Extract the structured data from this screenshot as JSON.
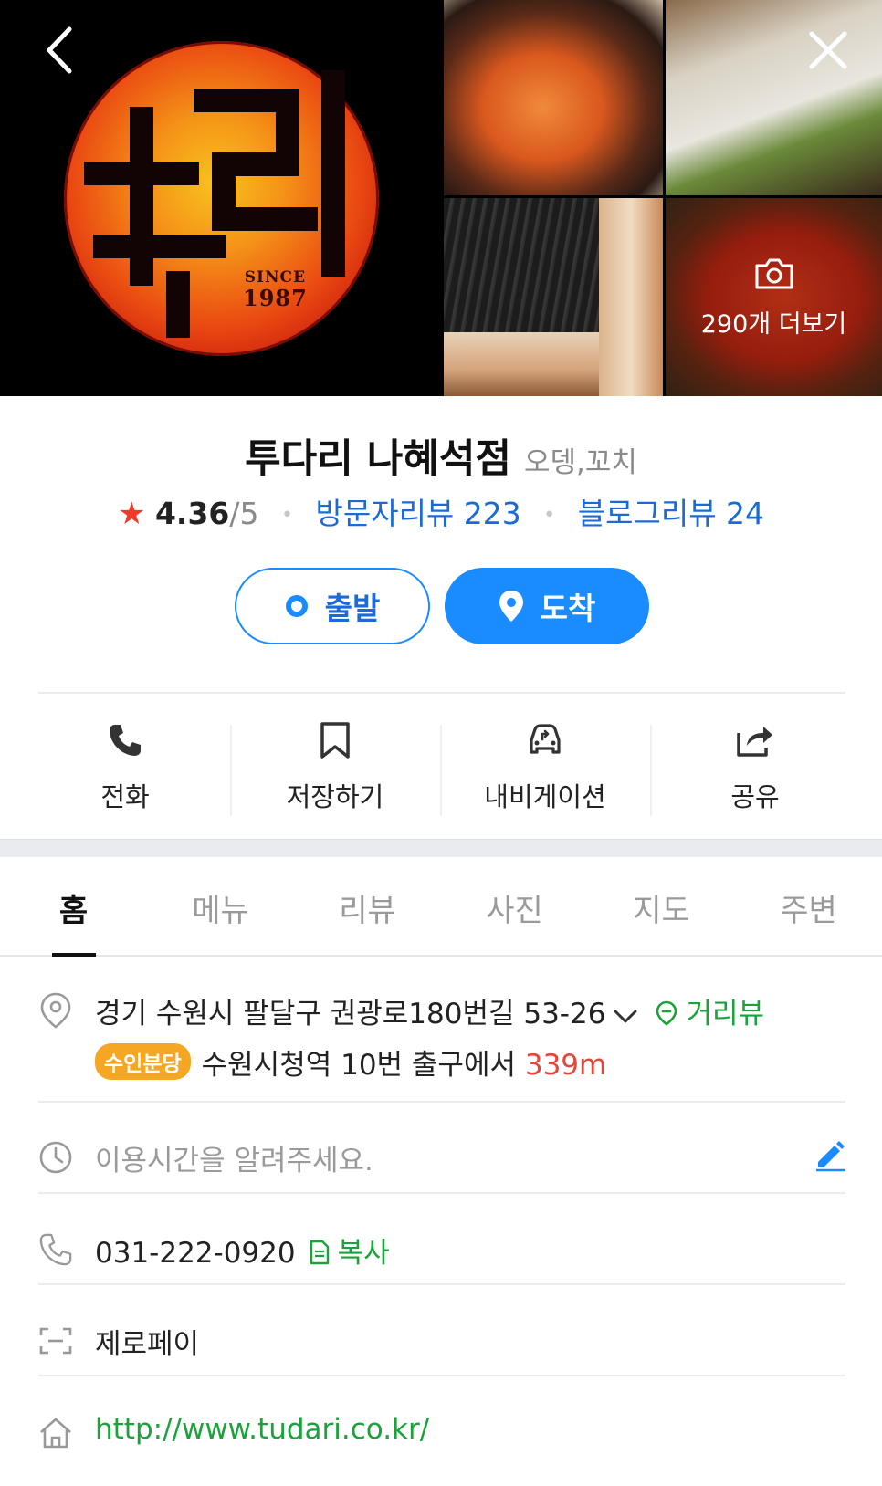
{
  "gallery": {
    "logo_since": "SINCE",
    "logo_year": "1987",
    "more_photos_label": "290개 더보기"
  },
  "place": {
    "name": "투다리 나혜석점",
    "category": "오뎅,꼬치",
    "rating": "4.36",
    "rating_max": "/5",
    "visitor_reviews": "방문자리뷰 223",
    "blog_reviews": "블로그리뷰 24"
  },
  "route_buttons": {
    "depart_label": "출발",
    "arrive_label": "도착"
  },
  "actions": [
    {
      "label": "전화",
      "icon": "phone-icon"
    },
    {
      "label": "저장하기",
      "icon": "bookmark-icon"
    },
    {
      "label": "내비게이션",
      "icon": "car-navigation-icon"
    },
    {
      "label": "공유",
      "icon": "share-icon"
    }
  ],
  "tabs": [
    "홈",
    "메뉴",
    "리뷰",
    "사진",
    "지도",
    "주변"
  ],
  "active_tab": "홈",
  "details": {
    "address": "경기 수원시 팔달구 권광로180번길 53-26",
    "street_view_label": "거리뷰",
    "subway_line": "수인분당",
    "subway_direction": "수원시청역 10번 출구에서",
    "subway_distance": "339m",
    "hours_placeholder": "이용시간을 알려주세요.",
    "phone": "031-222-0920",
    "copy_label": "복사",
    "payment": "제로페이",
    "homepage": "http://www.tudari.co.kr/"
  },
  "colors": {
    "accent_blue": "#1a8cff",
    "link_blue": "#1a6bd6",
    "green": "#1aa33a",
    "star_red": "#ee3a2c",
    "distance_red": "#e5463a",
    "subway_badge": "#f5a623"
  }
}
